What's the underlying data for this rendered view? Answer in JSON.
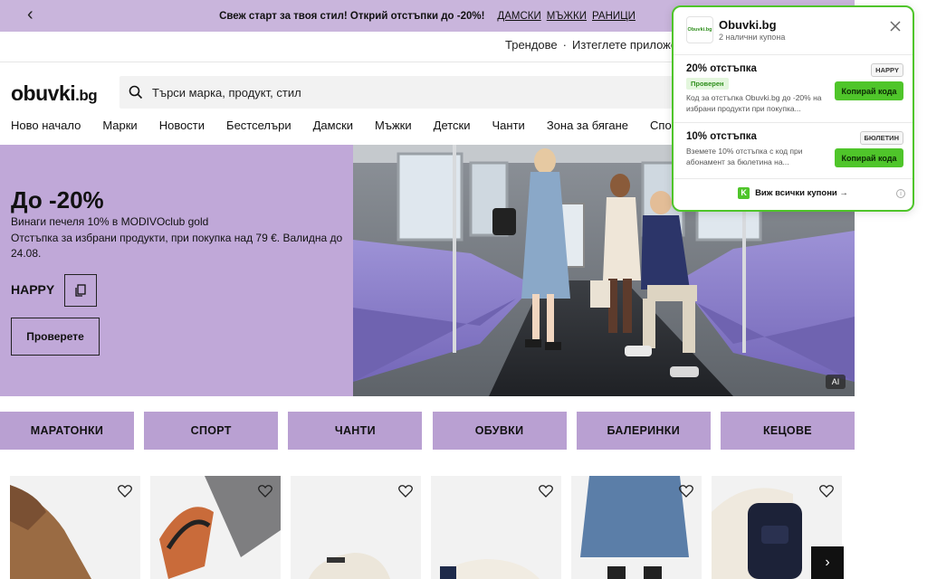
{
  "promo": {
    "text": "Свеж старт за твоя стил! Открий отстъпки до -20%!",
    "links": [
      "ДАМСКИ",
      "МЪЖКИ",
      "РАНИЦИ"
    ]
  },
  "secondary": {
    "trends": "Трендове",
    "separator": "·",
    "app": "Изтеглете приложен"
  },
  "header": {
    "logo_main": "obuvki",
    "logo_tld": ".bg",
    "search_placeholder": "Търси марка, продукт, стил"
  },
  "nav": [
    "Ново начало",
    "Марки",
    "Новости",
    "Бестселъри",
    "Дамски",
    "Мъжки",
    "Детски",
    "Чанти",
    "Зона за бягане",
    "Спорт"
  ],
  "hero": {
    "title": "До -20%",
    "line1": "Винаги печеля 10% в MODIVOclub gold",
    "line2": "Отстъпка за избрани продукти, при покупка над 79 €. Валидна до 24.08.",
    "code": "HAPPY",
    "check_button": "Проверете",
    "ai_badge": "AI"
  },
  "categories": [
    "МАРАТОНКИ",
    "СПОРТ",
    "ЧАНТИ",
    "ОБУВКИ",
    "БАЛЕРИНКИ",
    "КЕЦОВЕ"
  ],
  "popup": {
    "logo_text": "Obuvki.bg",
    "name": "Obuvki.bg",
    "subtitle": "2 налични купона",
    "coupons": [
      {
        "title": "20% отстъпка",
        "tag": "HAPPY",
        "verified": "Проверен",
        "desc": "Код за отстъпка Obuvki.bg до -20% на избрани продукти при покупка...",
        "button": "Копирай кода"
      },
      {
        "title": "10% отстъпка",
        "tag": "БЮЛЕТИН",
        "desc": "Вземете 10% отстъпка с код при абонамент за бюлетина на...",
        "button": "Копирай кода"
      }
    ],
    "all_coupons": "Виж всички купони →",
    "info": "i"
  },
  "colors": {
    "promo_bg": "#c9b5dc",
    "hero_bg": "#c0a8d8",
    "category_bg": "#b9a0d2",
    "accent_green": "#4fc52a"
  }
}
